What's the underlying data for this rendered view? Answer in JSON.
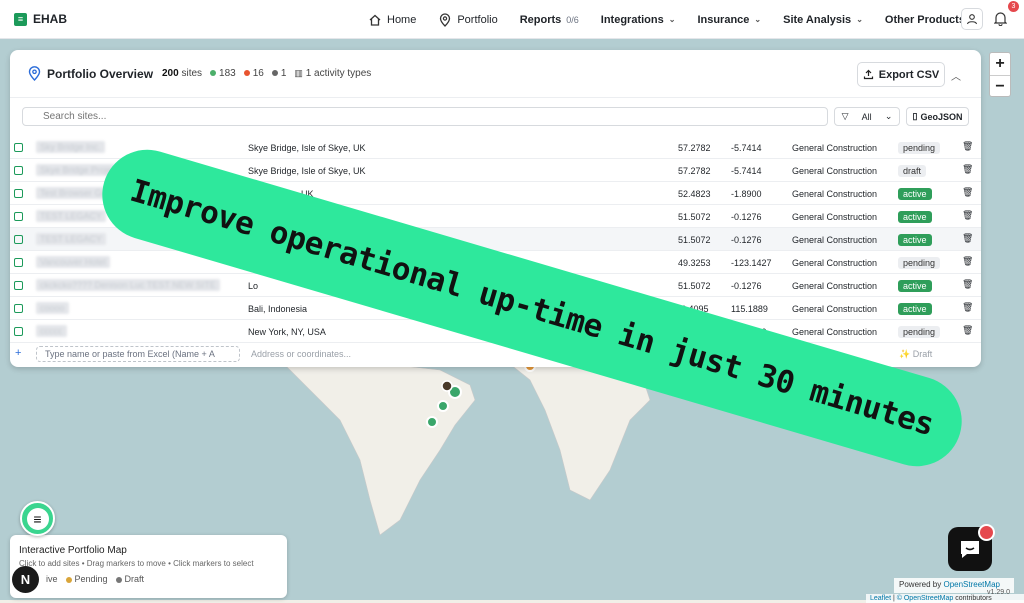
{
  "nav": {
    "brand": "EHAB",
    "home": "Home",
    "portfolio": "Portfolio",
    "reports": "Reports",
    "reports_count": "0/6",
    "integrations": "Integrations",
    "insurance": "Insurance",
    "site_analysis": "Site Analysis",
    "other_products": "Other Products",
    "notifications_count": "3"
  },
  "map_controls": {
    "zoom_in": "+",
    "zoom_out": "−"
  },
  "panel": {
    "title": "Portfolio Overview",
    "sites_count": "200",
    "sites_label": "sites",
    "active_count": "183",
    "pending_count": "16",
    "draft_count": "1",
    "activity_types": "1 activity types",
    "export_label": "Export CSV",
    "search_placeholder": "Search sites...",
    "filter_value": "All",
    "geojson_label": "GeoJSON",
    "colors": {
      "active": "#2f9e5a",
      "pending": "#e8542f",
      "draft": "#666666",
      "accent": "#1c9a5a"
    }
  },
  "rows": [
    {
      "name": "Sky Bridge Inc.",
      "address": "Skye Bridge, Isle of Skye, UK",
      "lat": "57.2782",
      "lng": "-5.7414",
      "type": "General Construction",
      "status": "pending"
    },
    {
      "name": "Skye Bridge Project",
      "address": "Skye Bridge, Isle of Skye, UK",
      "lat": "57.2782",
      "lng": "-5.7414",
      "type": "General Construction",
      "status": "draft"
    },
    {
      "name": "Test Browser Gold",
      "address": "Birmingham, UK",
      "lat": "52.4823",
      "lng": "-1.8900",
      "type": "General Construction",
      "status": "active"
    },
    {
      "name": "TEST LEGACY",
      "address": "London, UK",
      "lat": "51.5072",
      "lng": "-0.1276",
      "type": "General Construction",
      "status": "active"
    },
    {
      "name": "TEST LEGACY",
      "address": "",
      "lat": "51.5072",
      "lng": "-0.1276",
      "type": "General Construction",
      "status": "active"
    },
    {
      "name": "Vancouver Hotel",
      "address": "Canada",
      "lat": "49.3253",
      "lng": "-123.1427",
      "type": "General Construction",
      "status": "pending"
    },
    {
      "name": "ckckcko???? Denison Luc TEST NEW SITE",
      "address": "Lo",
      "lat": "51.5072",
      "lng": "-0.1276",
      "type": "General Construction",
      "status": "active"
    },
    {
      "name": "coooo",
      "address": "Bali, Indonesia",
      "lat": "-8.4095",
      "lng": "115.1889",
      "type": "General Construction",
      "status": "active"
    },
    {
      "name": "ccccc",
      "address": "New York, NY, USA",
      "lat": ".7128",
      "lng": "-74.0060",
      "type": "General Construction",
      "status": "pending"
    }
  ],
  "add_row": {
    "plus": "+",
    "name_placeholder": "Type name or paste from Excel (Name + A",
    "address_placeholder": "Address or coordinates...",
    "type_placeholder": "General",
    "status_placeholder": "✨ Draft"
  },
  "banner": {
    "text": "Improve operational up-time in just 30 minutes"
  },
  "legend": {
    "title": "Interactive Portfolio Map",
    "subtitle": "Click to add sites • Drag markers to move • Click markers to select",
    "active": "ive",
    "pending": "Pending",
    "draft": "Draft"
  },
  "footer": {
    "powered_prefix": "Powered by",
    "powered_link": "OpenStreetMap",
    "leaflet": "Leaflet",
    "osm_copy": "© OpenStreetMap",
    "contributors": "contributors",
    "version": "v1.29.0"
  },
  "misc": {
    "n_button": "N"
  }
}
